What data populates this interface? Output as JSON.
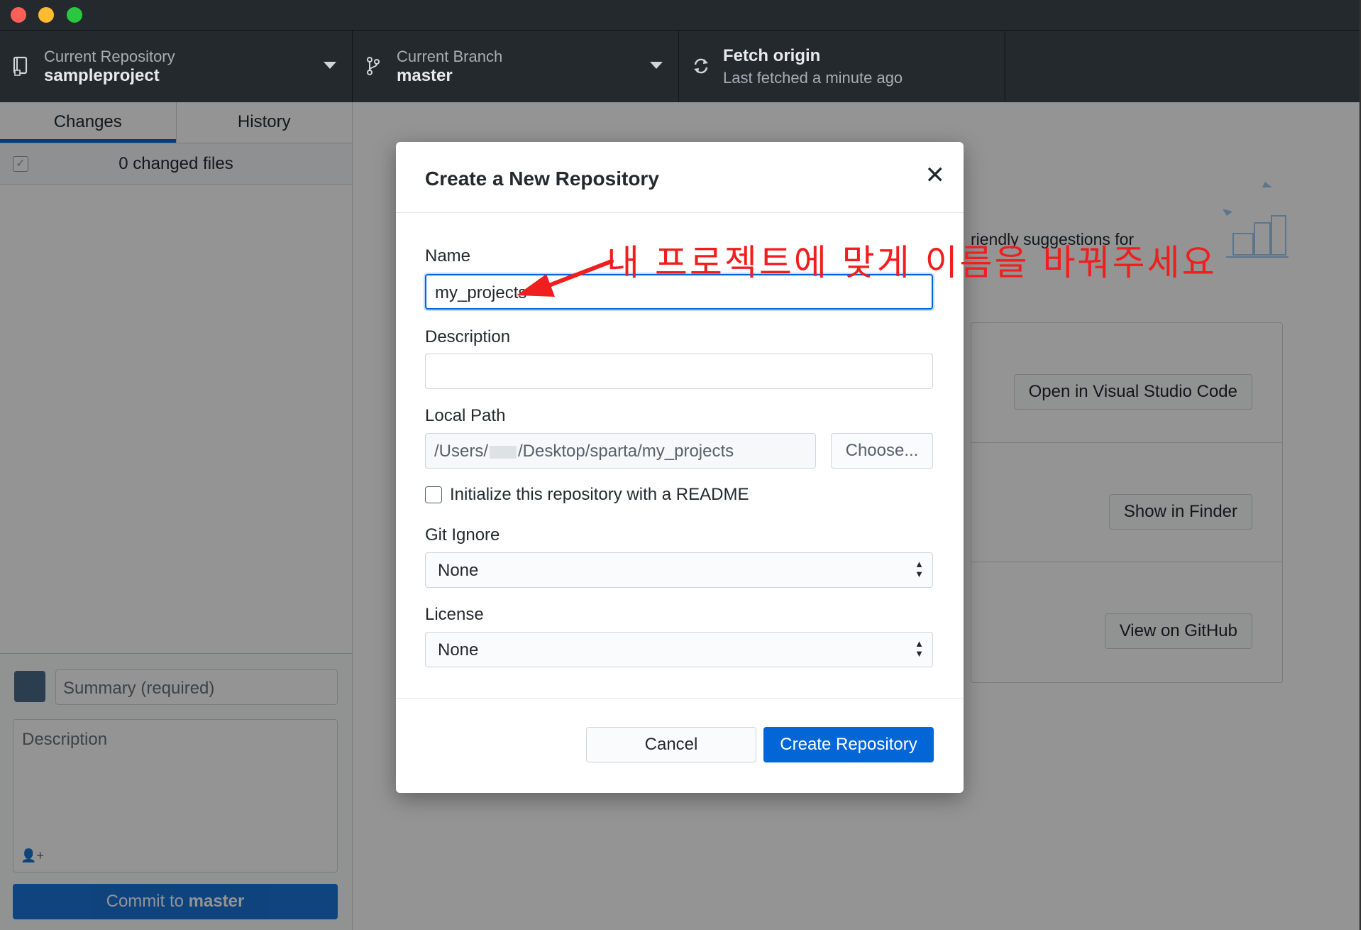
{
  "toolbar": {
    "repo": {
      "label": "Current Repository",
      "value": "sampleproject"
    },
    "branch": {
      "label": "Current Branch",
      "value": "master"
    },
    "fetch": {
      "label": "Fetch origin",
      "value": "Last fetched a minute ago"
    }
  },
  "sidebar": {
    "tabs": [
      {
        "label": "Changes"
      },
      {
        "label": "History"
      }
    ],
    "changed_files": "0 changed files",
    "summary_placeholder": "Summary (required)",
    "description_placeholder": "Description",
    "commit_button": {
      "prefix": "Commit to ",
      "branch": "master"
    }
  },
  "main": {
    "suggestion_text": "riendly suggestions for",
    "buttons": [
      {
        "label": "Open in Visual Studio Code"
      },
      {
        "label": "Show in Finder"
      },
      {
        "label": "View on GitHub"
      }
    ]
  },
  "dialog": {
    "title": "Create a New Repository",
    "close": "✕",
    "name_label": "Name",
    "name_value": "my_projects",
    "description_label": "Description",
    "description_value": "",
    "local_path_label": "Local Path",
    "local_path_prefix": "/Users/",
    "local_path_suffix": "/Desktop/sparta/my_projects",
    "choose_button": "Choose...",
    "readme_label": "Initialize this repository with a README",
    "readme_checked": false,
    "gitignore_label": "Git Ignore",
    "gitignore_value": "None",
    "license_label": "License",
    "license_value": "None",
    "cancel_button": "Cancel",
    "create_button": "Create Repository"
  },
  "annotation": {
    "text": "내 프로젝트에 맞게 이름을 바꿔주세요",
    "color": "#f01e1e"
  },
  "colors": {
    "toolbar_bg": "#24292e",
    "accent": "#0366d6"
  }
}
